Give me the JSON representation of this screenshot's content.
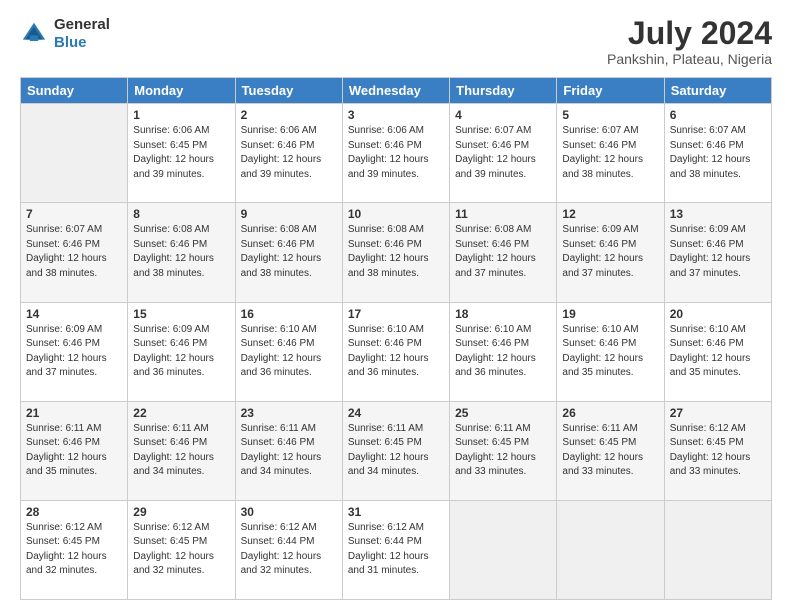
{
  "header": {
    "logo": {
      "line1": "General",
      "line2": "Blue"
    },
    "title": "July 2024",
    "subtitle": "Pankshin, Plateau, Nigeria"
  },
  "calendar": {
    "headers": [
      "Sunday",
      "Monday",
      "Tuesday",
      "Wednesday",
      "Thursday",
      "Friday",
      "Saturday"
    ],
    "weeks": [
      [
        {
          "day": "",
          "info": ""
        },
        {
          "day": "1",
          "info": "Sunrise: 6:06 AM\nSunset: 6:45 PM\nDaylight: 12 hours\nand 39 minutes."
        },
        {
          "day": "2",
          "info": "Sunrise: 6:06 AM\nSunset: 6:46 PM\nDaylight: 12 hours\nand 39 minutes."
        },
        {
          "day": "3",
          "info": "Sunrise: 6:06 AM\nSunset: 6:46 PM\nDaylight: 12 hours\nand 39 minutes."
        },
        {
          "day": "4",
          "info": "Sunrise: 6:07 AM\nSunset: 6:46 PM\nDaylight: 12 hours\nand 39 minutes."
        },
        {
          "day": "5",
          "info": "Sunrise: 6:07 AM\nSunset: 6:46 PM\nDaylight: 12 hours\nand 38 minutes."
        },
        {
          "day": "6",
          "info": "Sunrise: 6:07 AM\nSunset: 6:46 PM\nDaylight: 12 hours\nand 38 minutes."
        }
      ],
      [
        {
          "day": "7",
          "info": "Sunrise: 6:07 AM\nSunset: 6:46 PM\nDaylight: 12 hours\nand 38 minutes."
        },
        {
          "day": "8",
          "info": "Sunrise: 6:08 AM\nSunset: 6:46 PM\nDaylight: 12 hours\nand 38 minutes."
        },
        {
          "day": "9",
          "info": "Sunrise: 6:08 AM\nSunset: 6:46 PM\nDaylight: 12 hours\nand 38 minutes."
        },
        {
          "day": "10",
          "info": "Sunrise: 6:08 AM\nSunset: 6:46 PM\nDaylight: 12 hours\nand 38 minutes."
        },
        {
          "day": "11",
          "info": "Sunrise: 6:08 AM\nSunset: 6:46 PM\nDaylight: 12 hours\nand 37 minutes."
        },
        {
          "day": "12",
          "info": "Sunrise: 6:09 AM\nSunset: 6:46 PM\nDaylight: 12 hours\nand 37 minutes."
        },
        {
          "day": "13",
          "info": "Sunrise: 6:09 AM\nSunset: 6:46 PM\nDaylight: 12 hours\nand 37 minutes."
        }
      ],
      [
        {
          "day": "14",
          "info": "Sunrise: 6:09 AM\nSunset: 6:46 PM\nDaylight: 12 hours\nand 37 minutes."
        },
        {
          "day": "15",
          "info": "Sunrise: 6:09 AM\nSunset: 6:46 PM\nDaylight: 12 hours\nand 36 minutes."
        },
        {
          "day": "16",
          "info": "Sunrise: 6:10 AM\nSunset: 6:46 PM\nDaylight: 12 hours\nand 36 minutes."
        },
        {
          "day": "17",
          "info": "Sunrise: 6:10 AM\nSunset: 6:46 PM\nDaylight: 12 hours\nand 36 minutes."
        },
        {
          "day": "18",
          "info": "Sunrise: 6:10 AM\nSunset: 6:46 PM\nDaylight: 12 hours\nand 36 minutes."
        },
        {
          "day": "19",
          "info": "Sunrise: 6:10 AM\nSunset: 6:46 PM\nDaylight: 12 hours\nand 35 minutes."
        },
        {
          "day": "20",
          "info": "Sunrise: 6:10 AM\nSunset: 6:46 PM\nDaylight: 12 hours\nand 35 minutes."
        }
      ],
      [
        {
          "day": "21",
          "info": "Sunrise: 6:11 AM\nSunset: 6:46 PM\nDaylight: 12 hours\nand 35 minutes."
        },
        {
          "day": "22",
          "info": "Sunrise: 6:11 AM\nSunset: 6:46 PM\nDaylight: 12 hours\nand 34 minutes."
        },
        {
          "day": "23",
          "info": "Sunrise: 6:11 AM\nSunset: 6:46 PM\nDaylight: 12 hours\nand 34 minutes."
        },
        {
          "day": "24",
          "info": "Sunrise: 6:11 AM\nSunset: 6:45 PM\nDaylight: 12 hours\nand 34 minutes."
        },
        {
          "day": "25",
          "info": "Sunrise: 6:11 AM\nSunset: 6:45 PM\nDaylight: 12 hours\nand 33 minutes."
        },
        {
          "day": "26",
          "info": "Sunrise: 6:11 AM\nSunset: 6:45 PM\nDaylight: 12 hours\nand 33 minutes."
        },
        {
          "day": "27",
          "info": "Sunrise: 6:12 AM\nSunset: 6:45 PM\nDaylight: 12 hours\nand 33 minutes."
        }
      ],
      [
        {
          "day": "28",
          "info": "Sunrise: 6:12 AM\nSunset: 6:45 PM\nDaylight: 12 hours\nand 32 minutes."
        },
        {
          "day": "29",
          "info": "Sunrise: 6:12 AM\nSunset: 6:45 PM\nDaylight: 12 hours\nand 32 minutes."
        },
        {
          "day": "30",
          "info": "Sunrise: 6:12 AM\nSunset: 6:44 PM\nDaylight: 12 hours\nand 32 minutes."
        },
        {
          "day": "31",
          "info": "Sunrise: 6:12 AM\nSunset: 6:44 PM\nDaylight: 12 hours\nand 31 minutes."
        },
        {
          "day": "",
          "info": ""
        },
        {
          "day": "",
          "info": ""
        },
        {
          "day": "",
          "info": ""
        }
      ]
    ]
  }
}
